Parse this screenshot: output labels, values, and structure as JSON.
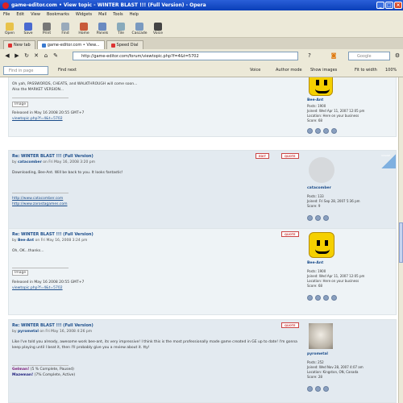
{
  "window": {
    "title": "game-editor.com • View topic - WINTER BLAST !!! (Full Version) - Opera"
  },
  "menu": [
    "File",
    "Edit",
    "View",
    "Bookmarks",
    "Widgets",
    "Mail",
    "Tools",
    "Help"
  ],
  "toolbar": [
    "Open",
    "Save",
    "Print",
    "Find",
    "Home",
    "Panels",
    "Tile",
    "Cascade",
    "Voice"
  ],
  "tabs": [
    {
      "label": "New tab",
      "color": "#d33"
    },
    {
      "label": "game-editor.com • View...",
      "color": "#3a7ad0"
    },
    {
      "label": "Speed Dial",
      "color": "#d33"
    }
  ],
  "address": {
    "url": "http://game-editor.com/forum/viewtopic.php?f=4&t=5702",
    "search_placeholder": "Google"
  },
  "findbar": {
    "find_placeholder": "Find in page",
    "find_next": "Find next",
    "voice": "Voice",
    "author_mode": "Author mode",
    "show_images": "Show images",
    "fit_to_width": "Fit to width",
    "zoom": "100%"
  },
  "posts": [
    {
      "body_lines": [
        "Oh yah, PASSWORDS, CHEATS, and WALKTHROUGH will come soon...",
        "Also the MARKET VERSION..."
      ],
      "image": "Image",
      "release": "Released in May 16 2008 20:55 GMT+7",
      "link": "viewtopic.php?f=4&t=5702",
      "user": "Bee-Ant",
      "posts": "Posts: 1900",
      "joined": "Joined: Wed Apr 11, 2007 12:05 pm",
      "location": "Location: Here on your business",
      "score": "Score: 68"
    },
    {
      "title": "Re: WINTER BLAST !!! (Full Version)",
      "by_prefix": "by ",
      "author": "catacomber",
      "date": " on Fri May 16, 2008 3:20 pm",
      "edit": "EDIT",
      "quote": "QUOTE",
      "online": "ONLINE",
      "body": "Downloading, Bee-Ant. Will be back to you. It looks fantastic!",
      "links": [
        "http://www.catacomber.com",
        "http://www.zarostagames.com"
      ],
      "user": "catacomber",
      "posts": "Posts: 133",
      "joined": "Joined: Fri Sep 28, 2007 5:36 pm",
      "score": "Score: 9"
    },
    {
      "title": "Re: WINTER BLAST !!! (Full Version)",
      "by_prefix": "by ",
      "author": "Bee-Ant",
      "date": " on Fri May 16, 2008 3:24 pm",
      "quote": "QUOTE",
      "body": "Oh, OK...thanks...",
      "image": "Image",
      "release": "Released in May 16 2008 20:55 GMT+7",
      "link": "viewtopic.php?f=4&t=5702",
      "user": "Bee-Ant",
      "posts": "Posts: 1900",
      "joined": "Joined: Wed Apr 11, 2007 12:05 pm",
      "location": "Location: Here on your business",
      "score": "Score: 68"
    },
    {
      "title": "Re: WINTER BLAST !!! (Full Version)",
      "by_prefix": "by ",
      "author": "pyrometal",
      "date": " on Fri May 16, 2008 4:26 pm",
      "quote": "QUOTE",
      "body": "Like I've told you already, awesome work bee-ant, its very impressive! I think this is the most professionally made game created in GE up to date! I'm gonna keep playing until I beat it, then I'll probably give you a review about it. tty!",
      "line1_name": "Gelman!",
      "line1_rest": " (5 % Complete, Paused)",
      "line2_name": "Mazeman!",
      "line2_rest": " (7% Complete, Active)",
      "user": "pyrometal",
      "posts": "Posts: 252",
      "joined": "Joined: Wed Nov 28, 2007 4:07 am",
      "location": "Location: Kingston, ON, Canada",
      "score": "Score: 28"
    }
  ]
}
